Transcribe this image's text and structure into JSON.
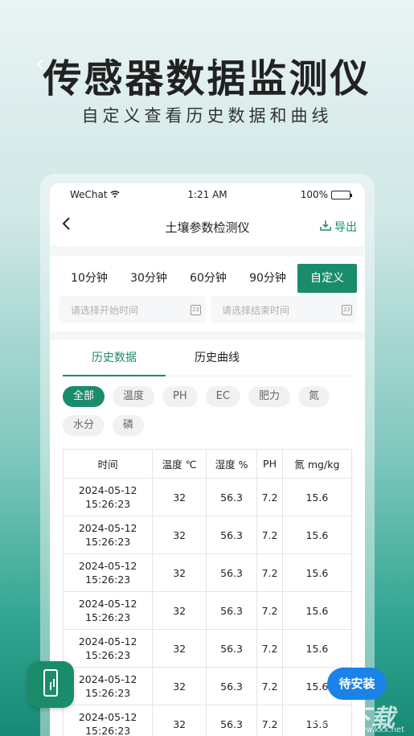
{
  "hero": {
    "title": "传感器数据监测仪",
    "subtitle": "自定义查看历史数据和曲线"
  },
  "status_bar": {
    "carrier": "WeChat",
    "time": "1:21 AM",
    "battery": "100%"
  },
  "nav": {
    "title": "土壤参数检测仪",
    "export_label": "导出"
  },
  "time_filter": {
    "options": [
      "10分钟",
      "30分钟",
      "60分钟",
      "90分钟",
      "自定义"
    ],
    "selected": "自定义",
    "start_placeholder": "请选择开始时间",
    "end_placeholder": "请选择结束时间"
  },
  "tabs": [
    {
      "label": "历史数据",
      "active": true
    },
    {
      "label": "历史曲线",
      "active": false
    }
  ],
  "chips": [
    {
      "label": "全部",
      "active": true
    },
    {
      "label": "温度",
      "active": false
    },
    {
      "label": "PH",
      "active": false
    },
    {
      "label": "EC",
      "active": false
    },
    {
      "label": "肥力",
      "active": false
    },
    {
      "label": "氮",
      "active": false
    },
    {
      "label": "水分",
      "active": false
    },
    {
      "label": "磷",
      "active": false
    }
  ],
  "table": {
    "headers": [
      "时间",
      "温度 ℃",
      "湿度 %",
      "PH",
      "氮 mg/kg"
    ],
    "rows": [
      {
        "date": "2024-05-12",
        "time": "15:26:23",
        "temp": "32",
        "humidity": "56.3",
        "ph": "7.2",
        "n": "15.6"
      },
      {
        "date": "2024-05-12",
        "time": "15:26:23",
        "temp": "32",
        "humidity": "56.3",
        "ph": "7.2",
        "n": "15.6"
      },
      {
        "date": "2024-05-12",
        "time": "15:26:23",
        "temp": "32",
        "humidity": "56.3",
        "ph": "7.2",
        "n": "15.6"
      },
      {
        "date": "2024-05-12",
        "time": "15:26:23",
        "temp": "32",
        "humidity": "56.3",
        "ph": "7.2",
        "n": "15.6"
      },
      {
        "date": "2024-05-12",
        "time": "15:26:23",
        "temp": "32",
        "humidity": "56.3",
        "ph": "7.2",
        "n": "15.6"
      },
      {
        "date": "2024-05-12",
        "time": "15:26:23",
        "temp": "32",
        "humidity": "56.3",
        "ph": "7.2",
        "n": "15.6"
      },
      {
        "date": "2024-05-12",
        "time": "15:26:23",
        "temp": "32",
        "humidity": "56.3",
        "ph": "7.2",
        "n": "15.6"
      }
    ]
  },
  "install_button": "待安装",
  "watermark": {
    "logo": "KK下载",
    "url": "www.kkx.net"
  },
  "colors": {
    "accent": "#1b8c6b",
    "install_blue": "#1a82e8"
  },
  "icons": [
    "back-icon",
    "export-icon",
    "calendar-icon",
    "wifi-icon",
    "battery-icon",
    "app-icon"
  ]
}
